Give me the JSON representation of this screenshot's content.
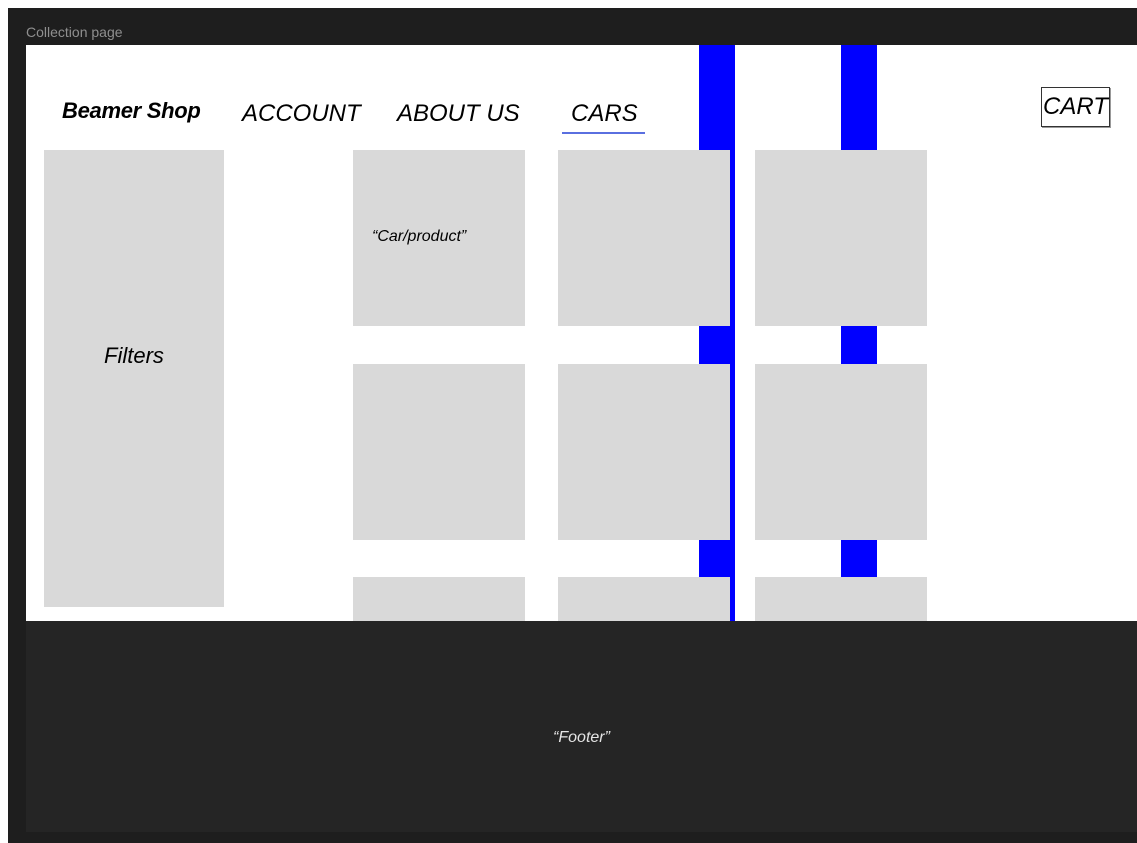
{
  "canvas": {
    "frame_label": "Collection page"
  },
  "header": {
    "logo": "Beamer Shop",
    "nav": {
      "account": "ACCOUNT",
      "about": "ABOUT US",
      "cars": "CARS"
    },
    "cart": "CART"
  },
  "sidebar": {
    "filters_label": "Filters"
  },
  "products": {
    "first_label": "“Car/product”"
  },
  "footer": {
    "label": "“Footer”"
  },
  "colors": {
    "overlay_blue": "#0000ff",
    "placeholder_gray": "#d9d9d9",
    "canvas_dark": "#1e1e1e",
    "footer_dark": "#252525",
    "active_underline": "#5a6fe0"
  }
}
